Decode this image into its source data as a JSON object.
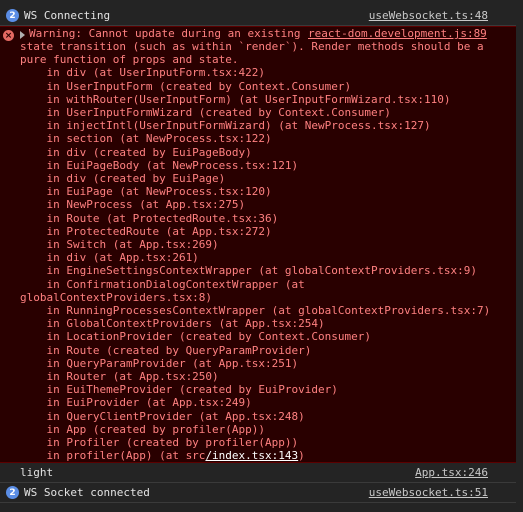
{
  "top_fragment": "",
  "rows": {
    "ws_connecting": {
      "badge": "2",
      "message": "WS Connecting",
      "source": "useWebsocket.ts:48"
    },
    "warning": {
      "head": "Warning: Cannot update during an existing",
      "source": "react-dom.development.js:89",
      "body_lines": [
        "state transition (such as within `render`). Render methods should be a",
        "pure function of props and state.",
        "    in div (at UserInputForm.tsx:422)",
        "    in UserInputForm (created by Context.Consumer)",
        "    in withRouter(UserInputForm) (at UserInputFormWizard.tsx:110)",
        "    in UserInputFormWizard (created by Context.Consumer)",
        "    in injectIntl(UserInputFormWizard) (at NewProcess.tsx:127)",
        "    in section (at NewProcess.tsx:122)",
        "    in div (created by EuiPageBody)",
        "    in EuiPageBody (at NewProcess.tsx:121)",
        "    in div (created by EuiPage)",
        "    in EuiPage (at NewProcess.tsx:120)",
        "    in NewProcess (at App.tsx:275)",
        "    in Route (at ProtectedRoute.tsx:36)",
        "    in ProtectedRoute (at App.tsx:272)",
        "    in Switch (at App.tsx:269)",
        "    in div (at App.tsx:261)",
        "    in EngineSettingsContextWrapper (at globalContextProviders.tsx:9)",
        "    in ConfirmationDialogContextWrapper (at",
        "globalContextProviders.tsx:8)",
        "    in RunningProcessesContextWrapper (at globalContextProviders.tsx:7)",
        "    in GlobalContextProviders (at App.tsx:254)",
        "    in LocationProvider (created by Context.Consumer)",
        "    in Route (created by QueryParamProvider)",
        "    in QueryParamProvider (at App.tsx:251)",
        "    in Router (at App.tsx:250)",
        "    in EuiThemeProvider (created by EuiProvider)",
        "    in EuiProvider (at App.tsx:249)",
        "    in QueryClientProvider (at App.tsx:248)",
        "    in App (created by profiler(App))",
        "    in Profiler (created by profiler(App))"
      ],
      "last_line_prefix": "    in profiler(App) (at src",
      "last_line_link": "/index.tsx:143",
      "last_line_suffix": ")"
    },
    "light": {
      "message": "light",
      "source": "App.tsx:246"
    },
    "ws_connected": {
      "badge": "2",
      "message": "WS Socket connected",
      "source": "useWebsocket.ts:51"
    }
  },
  "icons": {
    "info_badge": "count-badge",
    "error_badge": "error-x-icon",
    "expand": "expand-triangle-icon"
  },
  "colors": {
    "background": "#242424",
    "error_bg": "#290000",
    "error_text": "#ff8080",
    "badge_blue": "#5b8ee6"
  }
}
